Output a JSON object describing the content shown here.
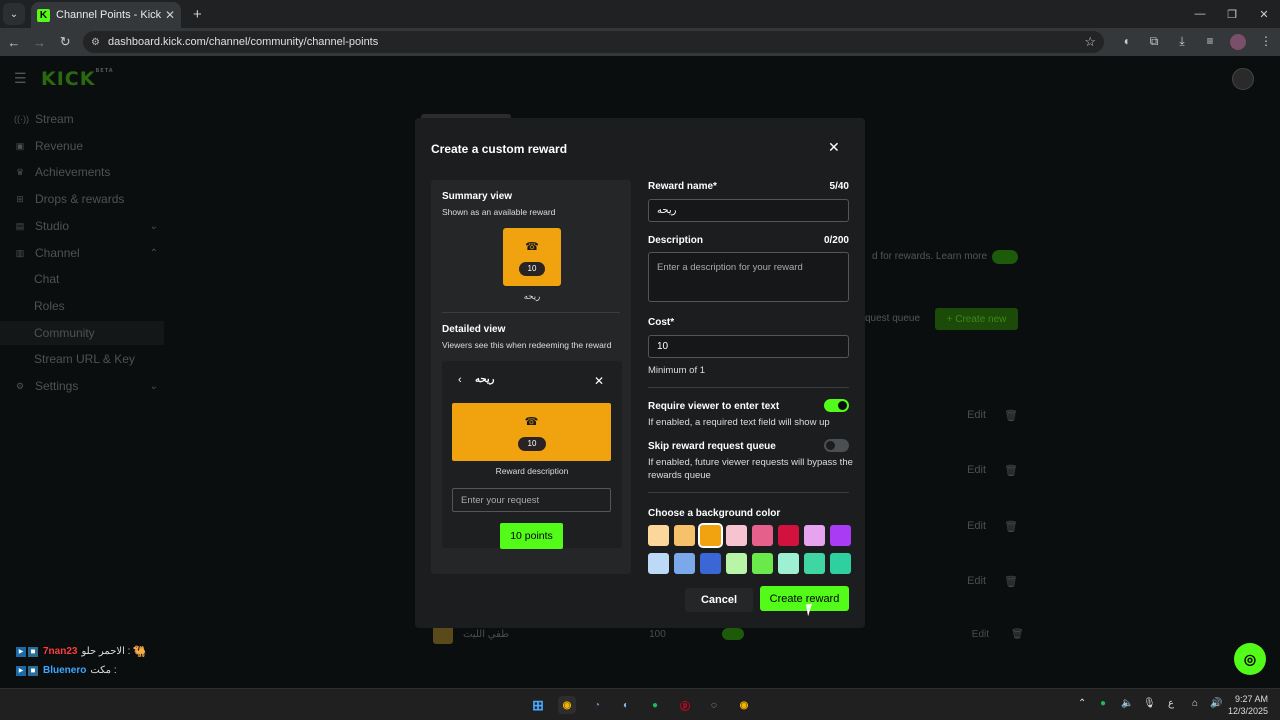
{
  "browser": {
    "tab_title": "Channel Points - Kick Dashboard",
    "url": "dashboard.kick.com/channel/community/channel-points"
  },
  "app": {
    "logo_text": "KICK",
    "logo_badge": "BETA"
  },
  "sidebar": {
    "items": [
      {
        "label": "Stream",
        "icon": "broadcast-icon"
      },
      {
        "label": "Revenue",
        "icon": "revenue-icon"
      },
      {
        "label": "Achievements",
        "icon": "trophy-icon"
      },
      {
        "label": "Drops & rewards",
        "icon": "drops-icon"
      },
      {
        "label": "Studio",
        "icon": "studio-icon"
      },
      {
        "label": "Channel",
        "icon": "channel-icon"
      },
      {
        "label": "Chat"
      },
      {
        "label": "Roles"
      },
      {
        "label": "Community"
      },
      {
        "label": "Stream URL & Key"
      },
      {
        "label": "Settings",
        "icon": "gear-icon"
      }
    ]
  },
  "chat_messages": [
    {
      "user": "7nan23",
      "message": "الاحمر حلو :",
      "user_color": "#ff3b3b"
    },
    {
      "user": "Bluenero",
      "message": "مكت :",
      "user_color": "#3ea6ff"
    }
  ],
  "background": {
    "learn_more": "d for rewards. Learn more",
    "queue_label": "quest queue",
    "create_new": "Create new",
    "edit_label": "Edit",
    "last_reward_name": "طفي الليت",
    "last_reward_cost": "100"
  },
  "modal": {
    "title": "Create a custom reward",
    "summary": {
      "heading": "Summary view",
      "sub": "Shown as an available reward",
      "cost": "10",
      "name": "ريحه"
    },
    "detail": {
      "heading": "Detailed view",
      "sub": "Viewers see this when redeeming the reward",
      "name": "ريحه",
      "cost": "10",
      "description": "Reward description",
      "input_placeholder": "Enter your request",
      "points_button": "10 points"
    },
    "form": {
      "name_label": "Reward name*",
      "name_count": "5/40",
      "name_value": "ريحه",
      "desc_label": "Description",
      "desc_count": "0/200",
      "desc_placeholder": "Enter a description for your reward",
      "cost_label": "Cost*",
      "cost_value": "10",
      "cost_help": "Minimum of 1",
      "require_label": "Require viewer to enter text",
      "require_help": "If enabled, a required text field will show up",
      "require_on": true,
      "skip_label": "Skip reward request queue",
      "skip_help": "If enabled, future viewer requests will bypass the rewards queue",
      "skip_on": false,
      "color_label": "Choose a background color",
      "colors_row1": [
        "#fcd79c",
        "#f5c26b",
        "#f0a30e",
        "#f5c4d0",
        "#e5608a",
        "#d2123e",
        "#e6a3f0",
        "#a93bf5"
      ],
      "colors_row2": [
        "#bcd9f5",
        "#7aa8ea",
        "#3a66d6",
        "#b8f5a6",
        "#6be84a",
        "#9ef0d2",
        "#3fd6a4",
        "#2fd0a0"
      ],
      "selected_color": "#f0a30e"
    },
    "cancel_label": "Cancel",
    "create_label": "Create reward"
  },
  "taskbar": {
    "time": "9:27 AM",
    "date": "12/3/2025",
    "lang": "ع"
  }
}
